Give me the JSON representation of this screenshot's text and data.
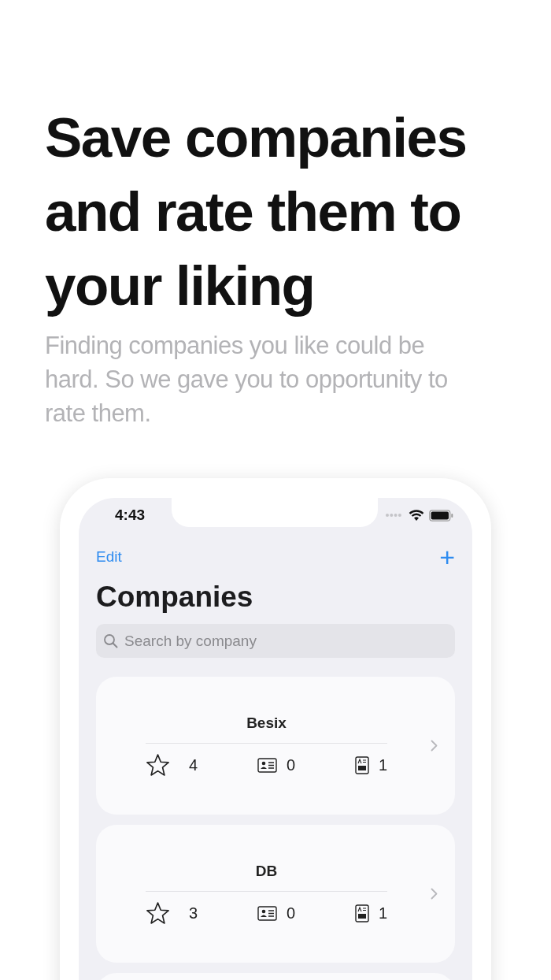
{
  "headline": "Save companies and rate them to your liking",
  "subtitle": "Finding companies you like could be hard. So we gave you to opportunity to rate them.",
  "phone": {
    "status_bar": {
      "time": "4:43"
    },
    "nav": {
      "edit": "Edit",
      "add": "+"
    },
    "title": "Companies",
    "search": {
      "placeholder": "Search by company"
    },
    "companies": [
      {
        "name": "Besix",
        "rating": "4",
        "contacts": "0",
        "documents": "1"
      },
      {
        "name": "DB",
        "rating": "3",
        "contacts": "0",
        "documents": "1"
      }
    ]
  }
}
